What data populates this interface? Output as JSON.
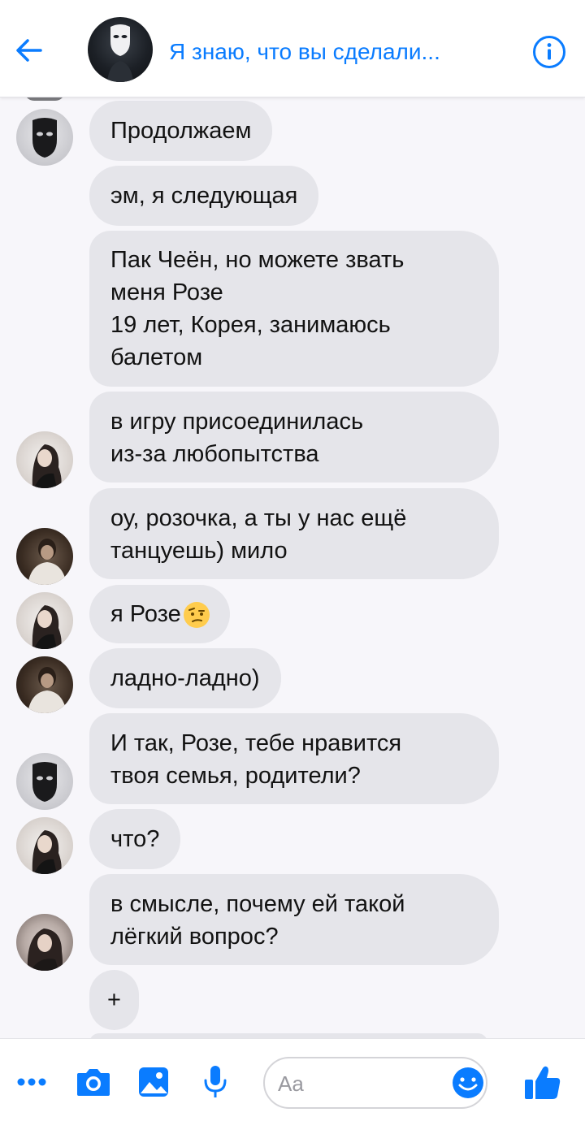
{
  "header": {
    "title": "Я знаю, что вы сделали...",
    "accent_color": "#0a7cff",
    "back_icon": "arrow-left-icon",
    "info_icon": "info-icon"
  },
  "messages": [
    {
      "sender": "mask",
      "text": "Продолжаем"
    },
    {
      "sender": "mask",
      "text": "эм, я следующая"
    },
    {
      "sender": "rose",
      "text": "Пак Чеён, но можете звать\nменя Розе\n19 лет, Корея, занимаюсь\nбалетом"
    },
    {
      "sender": "rose",
      "text": "в игру присоединилась\nиз-за любопытства"
    },
    {
      "sender": "taehyung",
      "text": "оу, розочка, а ты у нас ещё\nтанцуешь) мило"
    },
    {
      "sender": "rose",
      "text": "я Розе",
      "emoji": "face-with-raised-eyebrow"
    },
    {
      "sender": "taehyung",
      "text": "ладно-ладно)"
    },
    {
      "sender": "mask",
      "text": "И так, Розе, тебе нравится\nтвоя семья, родители?"
    },
    {
      "sender": "rose",
      "text": "что?"
    },
    {
      "sender": "jennie",
      "text": "в смысле, почему ей такой\nлёгкий вопрос?"
    },
    {
      "sender": "jennie",
      "text": "+"
    }
  ],
  "composer": {
    "placeholder": "Aa",
    "icons": [
      "more-icon",
      "camera-icon",
      "image-icon",
      "microphone-icon",
      "emoji-icon",
      "thumbs-up-icon"
    ],
    "icon_color": "#0a7cff"
  }
}
